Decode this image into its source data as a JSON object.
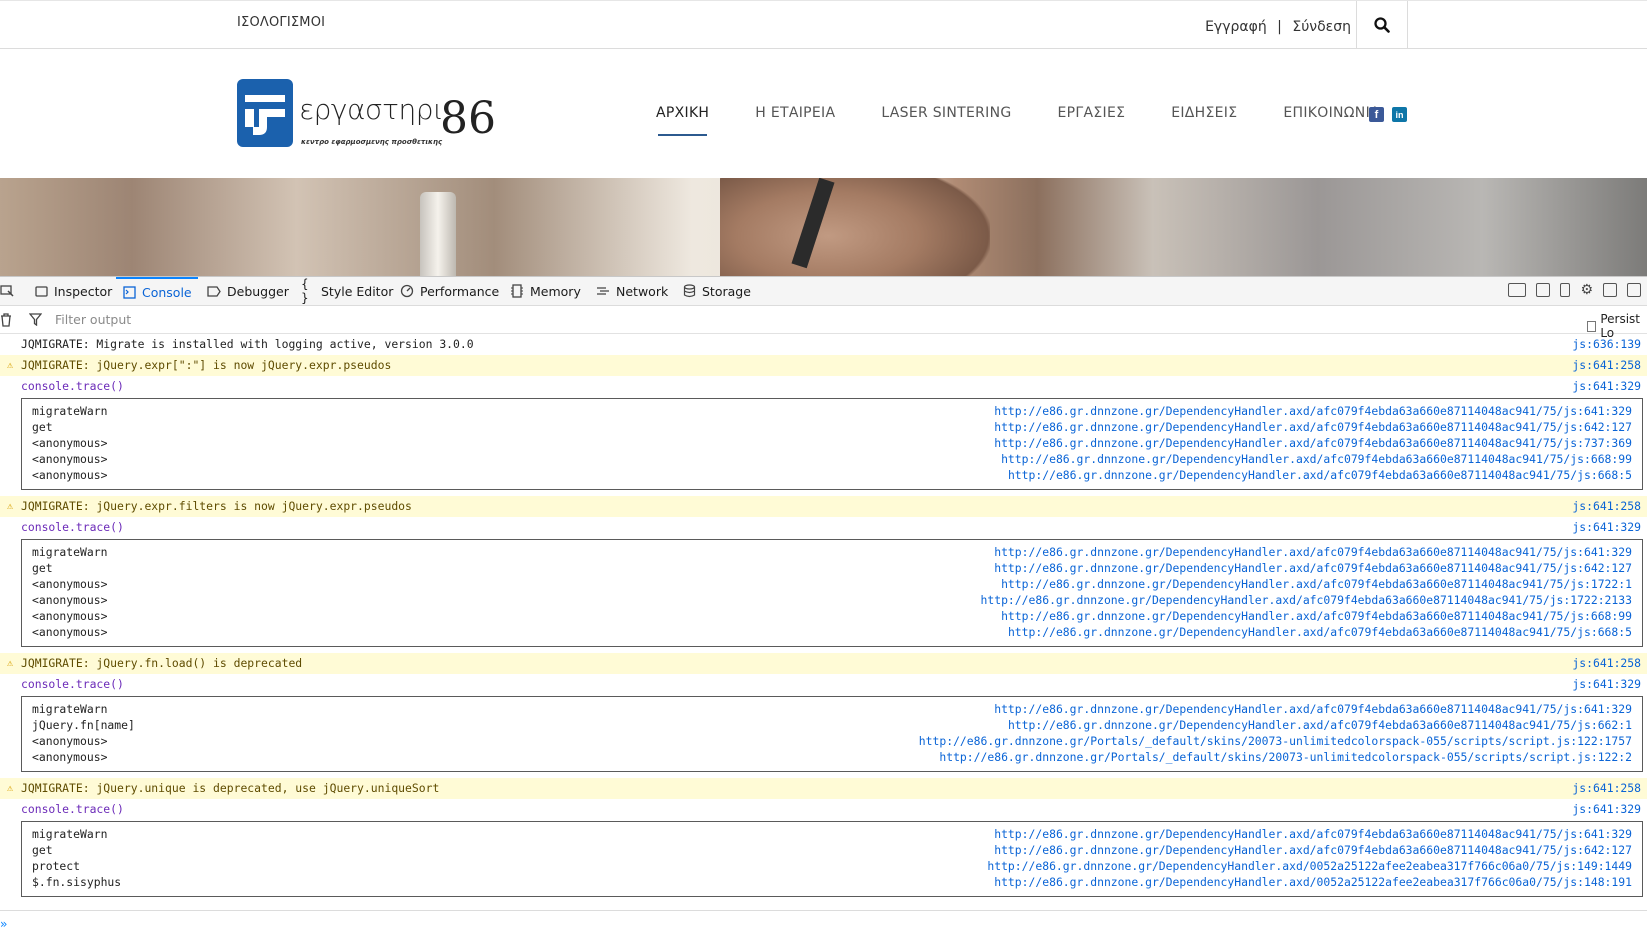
{
  "site": {
    "top_left_link": "ΙΣΟΛΟΓΙΣΜΟΙ",
    "register": "Εγγραφή",
    "separator": "|",
    "login": "Σύνδεση",
    "logo_text": "εργαστηρι",
    "logo_number": "86",
    "logo_tagline": "κεντρο εφαρμοσμενης προσθετικης",
    "nav": [
      "ΑΡΧΙΚΗ",
      "Η ΕΤΑΙΡΕΙΑ",
      "LASER SINTERING",
      "ΕΡΓΑΣΙΕΣ",
      "ΕΙΔΗΣΕΙΣ",
      "ΕΠΙΚΟΙΝΩΝΙΑ"
    ],
    "active_nav": "ΑΡΧΙΚΗ",
    "social": [
      "f",
      "in"
    ],
    "colors": {
      "brand_blue": "#1b61ad",
      "facebook": "#3b5998",
      "linkedin": "#0e76a8"
    }
  },
  "devtools": {
    "tabs": [
      "Inspector",
      "Console",
      "Debugger",
      "Style Editor",
      "Performance",
      "Memory",
      "Network",
      "Storage"
    ],
    "active_tab": "Console",
    "filter_placeholder": "Filter output",
    "persist_logs_label": "Persist Lo",
    "messages": [
      {
        "type": "log",
        "text": "JQMIGRATE: Migrate is installed with logging active, version 3.0.0",
        "loc": "js:636:139"
      },
      {
        "type": "warn",
        "text": "JQMIGRATE: jQuery.expr[\":\"] is now jQuery.expr.pseudos",
        "loc": "js:641:258"
      },
      {
        "type": "trace",
        "text": "console.trace()",
        "loc": "js:641:329"
      },
      {
        "type": "warn",
        "text": "JQMIGRATE: jQuery.expr.filters is now jQuery.expr.pseudos",
        "loc": "js:641:258"
      },
      {
        "type": "trace",
        "text": "console.trace()",
        "loc": "js:641:329"
      },
      {
        "type": "warn",
        "text": "JQMIGRATE: jQuery.fn.load() is deprecated",
        "loc": "js:641:258"
      },
      {
        "type": "trace",
        "text": "console.trace()",
        "loc": "js:641:329"
      },
      {
        "type": "warn",
        "text": "JQMIGRATE: jQuery.unique is deprecated, use jQuery.uniqueSort",
        "loc": "js:641:258"
      },
      {
        "type": "trace",
        "text": "console.trace()",
        "loc": "js:641:329"
      }
    ],
    "stacks": [
      [
        {
          "fn": "migrateWarn",
          "url": "http://e86.gr.dnnzone.gr/DependencyHandler.axd/afc079f4ebda63a660e87114048ac941/75/js:641:329"
        },
        {
          "fn": "get",
          "url": "http://e86.gr.dnnzone.gr/DependencyHandler.axd/afc079f4ebda63a660e87114048ac941/75/js:642:127"
        },
        {
          "fn": "<anonymous>",
          "url": "http://e86.gr.dnnzone.gr/DependencyHandler.axd/afc079f4ebda63a660e87114048ac941/75/js:737:369"
        },
        {
          "fn": "<anonymous>",
          "url": "http://e86.gr.dnnzone.gr/DependencyHandler.axd/afc079f4ebda63a660e87114048ac941/75/js:668:99"
        },
        {
          "fn": "<anonymous>",
          "url": "http://e86.gr.dnnzone.gr/DependencyHandler.axd/afc079f4ebda63a660e87114048ac941/75/js:668:5"
        }
      ],
      [
        {
          "fn": "migrateWarn",
          "url": "http://e86.gr.dnnzone.gr/DependencyHandler.axd/afc079f4ebda63a660e87114048ac941/75/js:641:329"
        },
        {
          "fn": "get",
          "url": "http://e86.gr.dnnzone.gr/DependencyHandler.axd/afc079f4ebda63a660e87114048ac941/75/js:642:127"
        },
        {
          "fn": "<anonymous>",
          "url": "http://e86.gr.dnnzone.gr/DependencyHandler.axd/afc079f4ebda63a660e87114048ac941/75/js:1722:1"
        },
        {
          "fn": "<anonymous>",
          "url": "http://e86.gr.dnnzone.gr/DependencyHandler.axd/afc079f4ebda63a660e87114048ac941/75/js:1722:2133"
        },
        {
          "fn": "<anonymous>",
          "url": "http://e86.gr.dnnzone.gr/DependencyHandler.axd/afc079f4ebda63a660e87114048ac941/75/js:668:99"
        },
        {
          "fn": "<anonymous>",
          "url": "http://e86.gr.dnnzone.gr/DependencyHandler.axd/afc079f4ebda63a660e87114048ac941/75/js:668:5"
        }
      ],
      [
        {
          "fn": "migrateWarn",
          "url": "http://e86.gr.dnnzone.gr/DependencyHandler.axd/afc079f4ebda63a660e87114048ac941/75/js:641:329"
        },
        {
          "fn": "jQuery.fn[name]",
          "url": "http://e86.gr.dnnzone.gr/DependencyHandler.axd/afc079f4ebda63a660e87114048ac941/75/js:662:1"
        },
        {
          "fn": "<anonymous>",
          "url": "http://e86.gr.dnnzone.gr/Portals/_default/skins/20073-unlimitedcolorspack-055/scripts/script.js:122:1757"
        },
        {
          "fn": "<anonymous>",
          "url": "http://e86.gr.dnnzone.gr/Portals/_default/skins/20073-unlimitedcolorspack-055/scripts/script.js:122:2"
        }
      ],
      [
        {
          "fn": "migrateWarn",
          "url": "http://e86.gr.dnnzone.gr/DependencyHandler.axd/afc079f4ebda63a660e87114048ac941/75/js:641:329"
        },
        {
          "fn": "get",
          "url": "http://e86.gr.dnnzone.gr/DependencyHandler.axd/afc079f4ebda63a660e87114048ac941/75/js:642:127"
        },
        {
          "fn": "protect",
          "url": "http://e86.gr.dnnzone.gr/DependencyHandler.axd/0052a25122afee2eabea317f766c06a0/75/js:149:1449"
        },
        {
          "fn": "$.fn.sisyphus",
          "url": "http://e86.gr.dnnzone.gr/DependencyHandler.axd/0052a25122afee2eabea317f766c06a0/75/js:148:191"
        }
      ]
    ]
  }
}
